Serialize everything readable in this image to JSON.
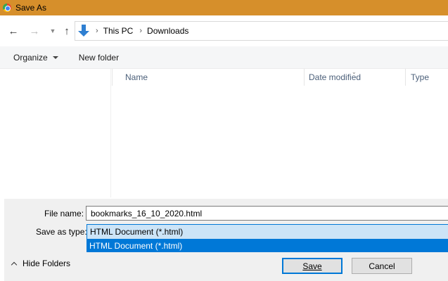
{
  "window": {
    "title": "Save As",
    "app_icon": "chrome-icon"
  },
  "navigation": {
    "back_icon": "back-arrow-icon",
    "forward_icon": "forward-arrow-icon",
    "recent_icon": "chevron-down-icon",
    "up_icon": "up-arrow-icon",
    "breadcrumb": [
      "This PC",
      "Downloads"
    ]
  },
  "toolbar": {
    "organize_label": "Organize",
    "new_folder_label": "New folder"
  },
  "file_list": {
    "columns": [
      "Name",
      "Date modified",
      "Type"
    ],
    "sort_icon": "chevron-down-icon",
    "rows": []
  },
  "form": {
    "file_name_label": "File name:",
    "file_name_value": "bookmarks_16_10_2020.html",
    "save_type_label": "Save as type:",
    "save_type_value": "HTML Document (*.html)",
    "save_type_options": [
      "HTML Document (*.html)"
    ]
  },
  "footer": {
    "hide_folders_label": "Hide Folders",
    "save_label": "Save",
    "cancel_label": "Cancel"
  },
  "colors": {
    "title_bar": "#d68f2b",
    "selection": "#0078d7",
    "select_bg": "#cce4f7",
    "panel_bg": "#f0f0f0"
  }
}
